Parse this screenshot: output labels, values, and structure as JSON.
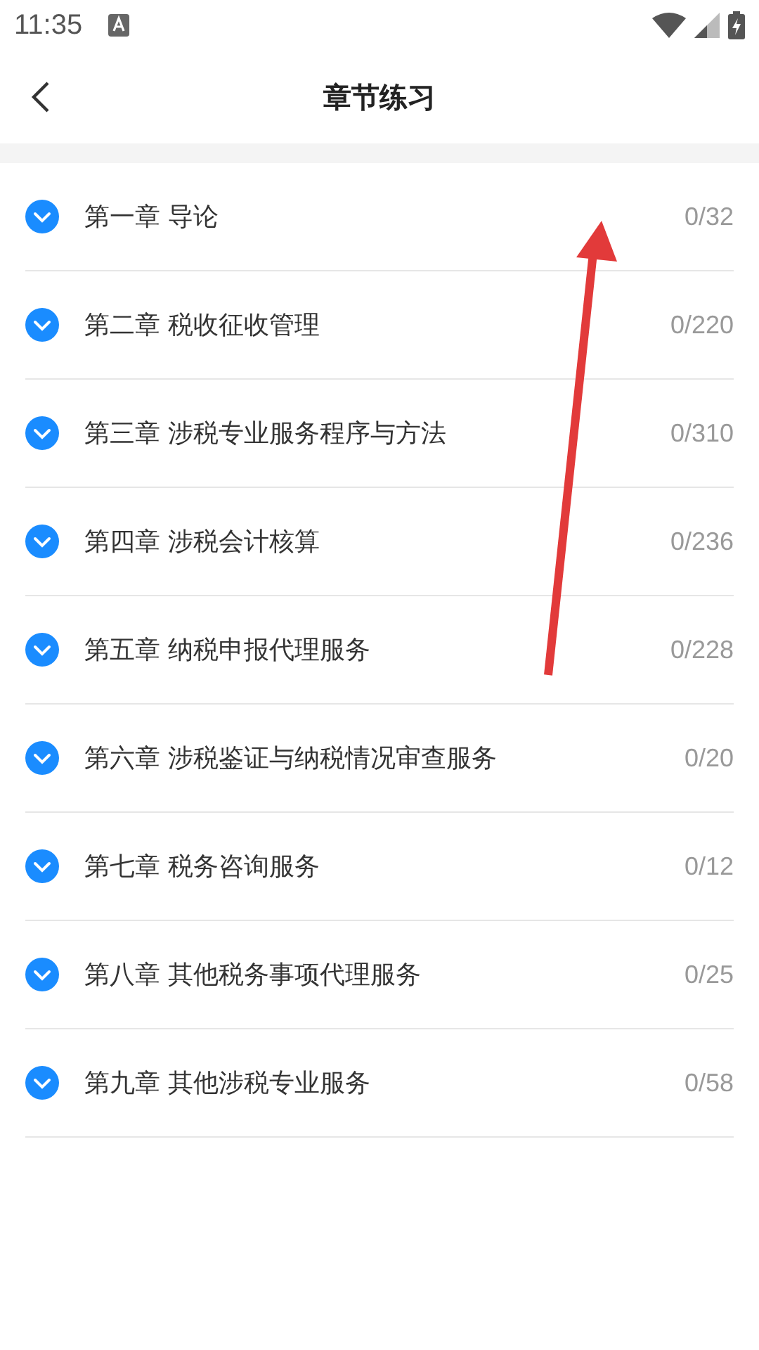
{
  "status_bar": {
    "time": "11:35"
  },
  "header": {
    "title": "章节练习"
  },
  "chapters": [
    {
      "title": "第一章 导论",
      "progress": "0/32"
    },
    {
      "title": "第二章 税收征收管理",
      "progress": "0/220"
    },
    {
      "title": "第三章 涉税专业服务程序与方法",
      "progress": "0/310"
    },
    {
      "title": "第四章 涉税会计核算",
      "progress": "0/236"
    },
    {
      "title": "第五章 纳税申报代理服务",
      "progress": "0/228"
    },
    {
      "title": "第六章 涉税鉴证与纳税情况审查服务",
      "progress": "0/20"
    },
    {
      "title": "第七章 税务咨询服务",
      "progress": "0/12"
    },
    {
      "title": "第八章 其他税务事项代理服务",
      "progress": "0/25"
    },
    {
      "title": "第九章 其他涉税专业服务",
      "progress": "0/58"
    }
  ]
}
